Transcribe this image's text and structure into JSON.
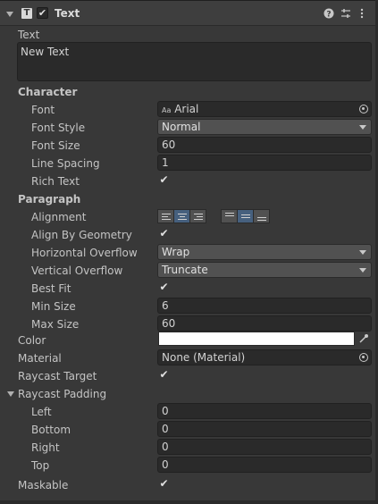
{
  "header": {
    "title": "Text",
    "enabled_check": "✔",
    "component_icon": "T",
    "icons": [
      "help-icon",
      "presets-icon",
      "more-vert-icon"
    ]
  },
  "text_label": "Text",
  "text_value": "New Text",
  "character": {
    "heading": "Character",
    "font_label": "Font",
    "font_prefix": "Aa",
    "font_value": "Arial",
    "font_style_label": "Font Style",
    "font_style_value": "Normal",
    "font_size_label": "Font Size",
    "font_size_value": "60",
    "line_spacing_label": "Line Spacing",
    "line_spacing_value": "1",
    "rich_text_label": "Rich Text",
    "rich_text_check": "✔"
  },
  "paragraph": {
    "heading": "Paragraph",
    "alignment_label": "Alignment",
    "align_by_geometry_label": "Align By Geometry",
    "align_by_geometry_check": "✔",
    "h_overflow_label": "Horizontal Overflow",
    "h_overflow_value": "Wrap",
    "v_overflow_label": "Vertical Overflow",
    "v_overflow_value": "Truncate",
    "best_fit_label": "Best Fit",
    "best_fit_check": "✔",
    "min_size_label": "Min Size",
    "min_size_value": "6",
    "max_size_label": "Max Size",
    "max_size_value": "60"
  },
  "color_label": "Color",
  "color_value": "#ffffff",
  "material_label": "Material",
  "material_value": "None (Material)",
  "raycast_target_label": "Raycast Target",
  "raycast_target_check": "✔",
  "raycast_padding": {
    "heading": "Raycast Padding",
    "left_label": "Left",
    "left_value": "0",
    "bottom_label": "Bottom",
    "bottom_value": "0",
    "right_label": "Right",
    "right_value": "0",
    "top_label": "Top",
    "top_value": "0"
  },
  "maskable_label": "Maskable",
  "maskable_check": "✔"
}
